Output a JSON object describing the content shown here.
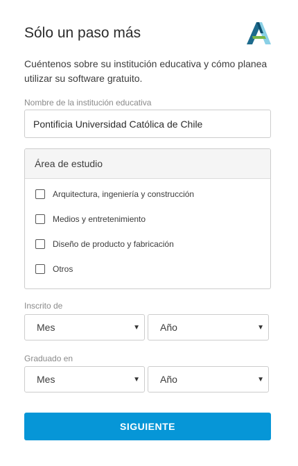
{
  "header": {
    "title": "Sólo un paso más",
    "logo_icon": "autodesk-logo"
  },
  "intro": "Cuéntenos sobre su institución educativa y cómo planea utilizar su software gratuito.",
  "institution": {
    "label": "Nombre de la institución educativa",
    "value": "Pontificia Universidad Católica de Chile"
  },
  "area": {
    "heading": "Área de estudio",
    "options": [
      {
        "label": "Arquitectura, ingeniería y construcción",
        "checked": false
      },
      {
        "label": "Medios y entretenimiento",
        "checked": false
      },
      {
        "label": "Diseño de producto y fabricación",
        "checked": false
      },
      {
        "label": "Otros",
        "checked": false
      }
    ]
  },
  "enrolled": {
    "label": "Inscrito de",
    "month_value": "Mes",
    "year_value": "Año"
  },
  "graduated": {
    "label": "Graduado en",
    "month_value": "Mes",
    "year_value": "Año"
  },
  "submit_label": "SIGUIENTE",
  "colors": {
    "accent": "#0696d7",
    "border": "#cccccc",
    "logo_dark": "#1d6a8c",
    "logo_light": "#8ad0e6",
    "logo_green": "#7ab648"
  }
}
